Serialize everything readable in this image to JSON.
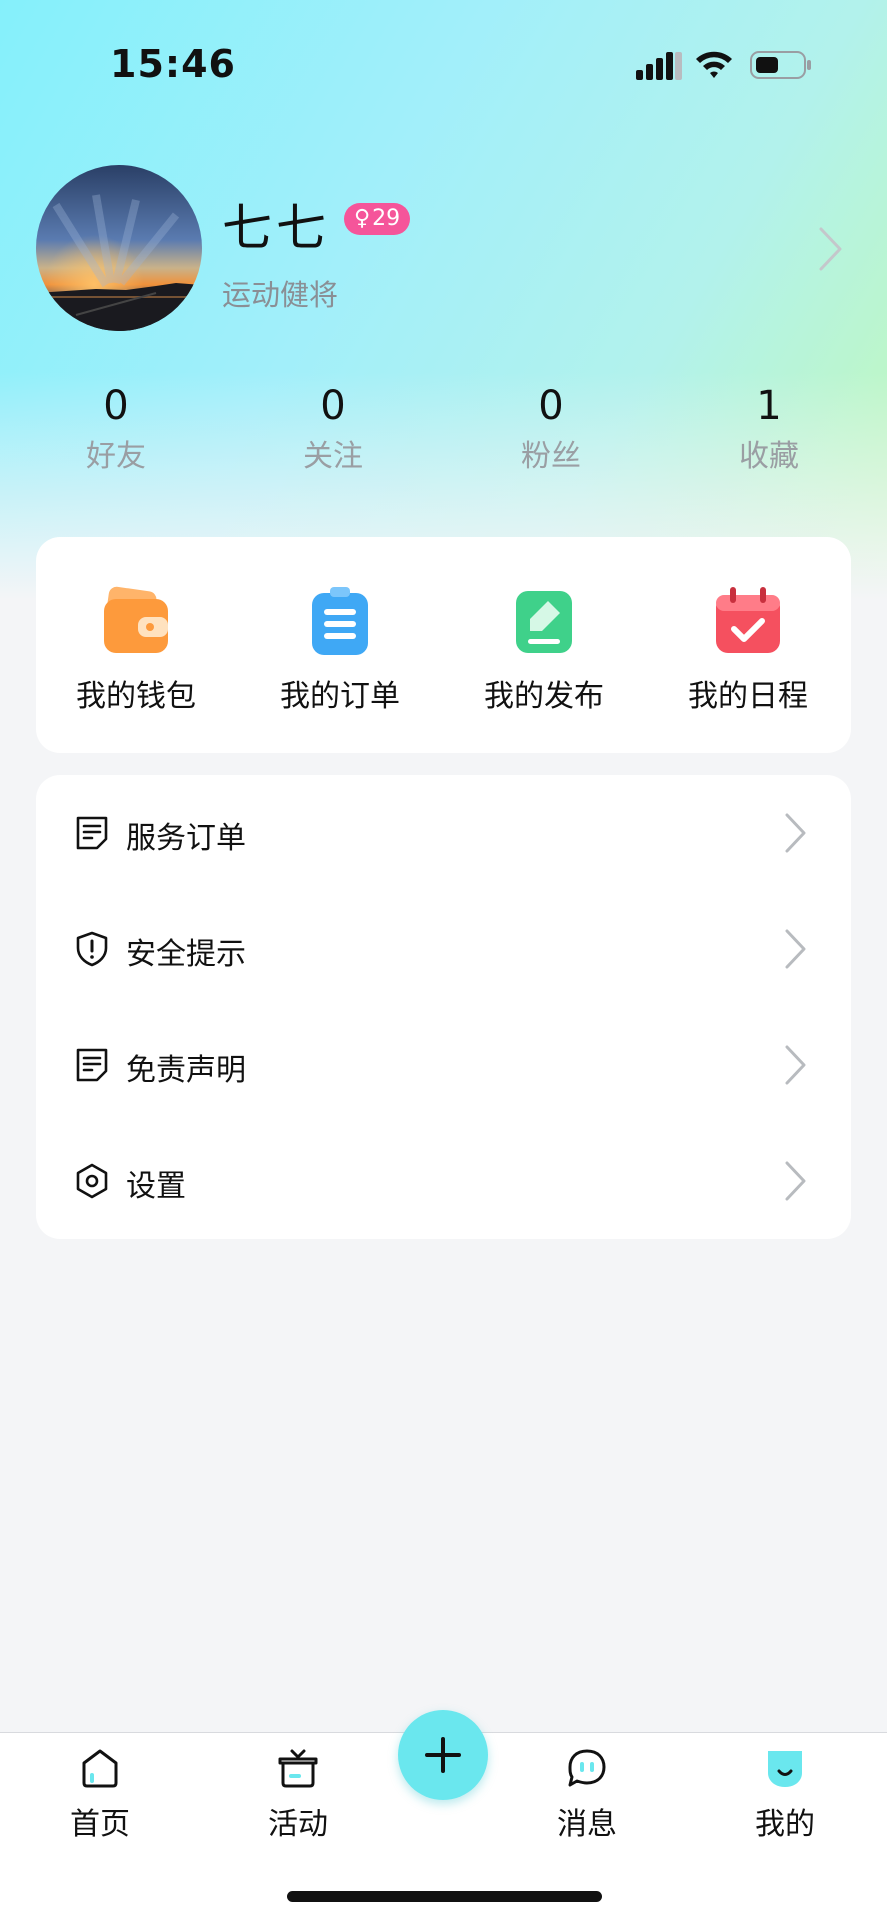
{
  "status_bar": {
    "time": "15:46"
  },
  "profile": {
    "name": "七七",
    "gender_symbol": "♀",
    "age": "29",
    "title": "运动健将"
  },
  "stats": [
    {
      "value": "0",
      "label": "好友"
    },
    {
      "value": "0",
      "label": "关注"
    },
    {
      "value": "0",
      "label": "粉丝"
    },
    {
      "value": "1",
      "label": "收藏"
    }
  ],
  "quick_actions": [
    {
      "label": "我的钱包",
      "icon": "wallet-icon"
    },
    {
      "label": "我的订单",
      "icon": "order-list-icon"
    },
    {
      "label": "我的发布",
      "icon": "publish-edit-icon"
    },
    {
      "label": "我的日程",
      "icon": "calendar-check-icon"
    }
  ],
  "menu": [
    {
      "label": "服务订单",
      "icon": "document-icon"
    },
    {
      "label": "安全提示",
      "icon": "shield-alert-icon"
    },
    {
      "label": "免责声明",
      "icon": "document-icon"
    },
    {
      "label": "设置",
      "icon": "hexagon-settings-icon"
    }
  ],
  "tab_bar": {
    "tabs": [
      {
        "label": "首页",
        "icon": "home-icon"
      },
      {
        "label": "活动",
        "icon": "activity-icon"
      },
      {
        "label": "消息",
        "icon": "chat-bubble-icon"
      },
      {
        "label": "我的",
        "icon": "profile-face-icon",
        "active": true
      }
    ],
    "center_button_icon": "plus-icon"
  },
  "colors": {
    "accent": "#6ae7ee",
    "badge": "#f5559a",
    "wallet": "#fd9a3c",
    "order": "#3fa8f5",
    "publish": "#3fd18a",
    "calendar": "#f5505f"
  }
}
